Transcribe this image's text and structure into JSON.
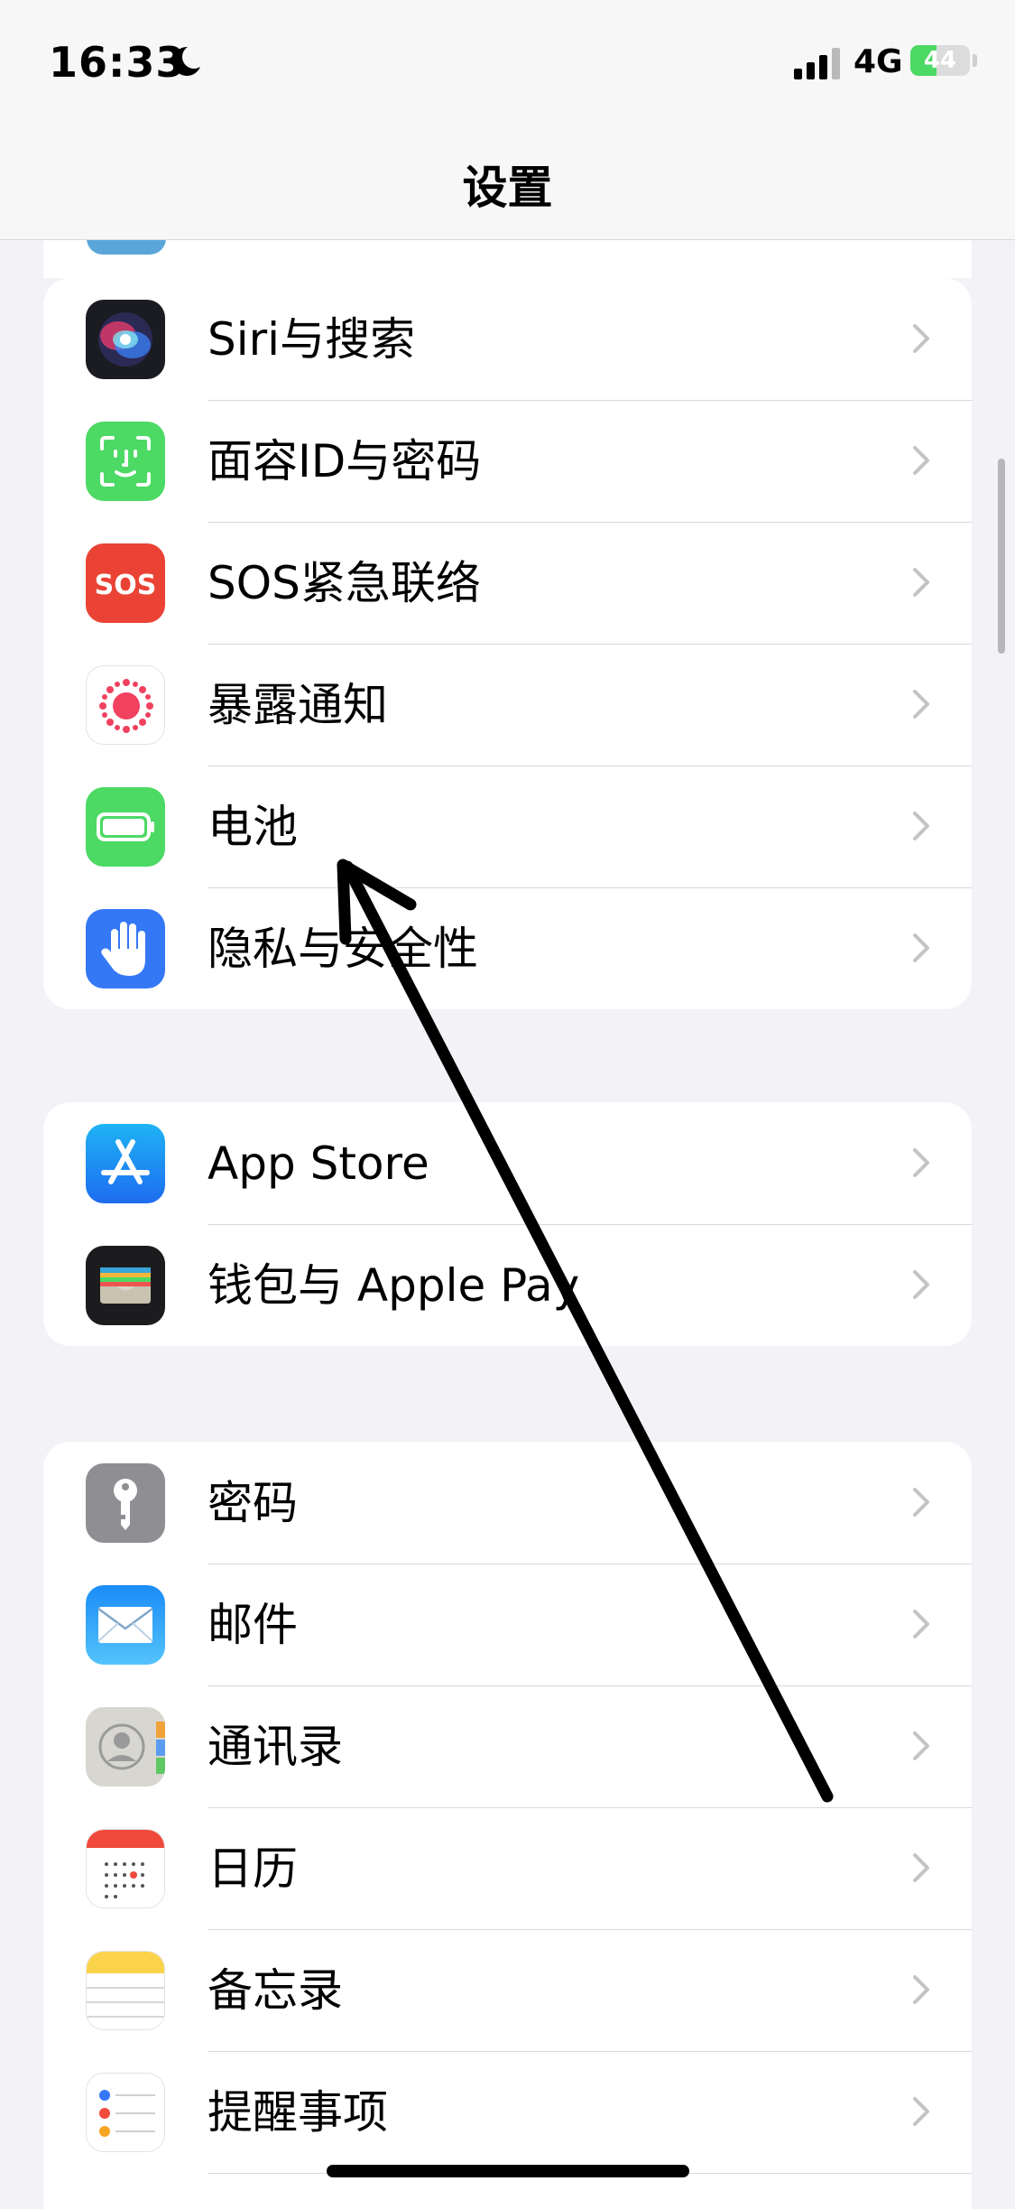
{
  "status_bar": {
    "time": "16:33",
    "network": "4G",
    "battery_text": "44",
    "battery_level": 0.44,
    "icons": [
      "moon-icon",
      "signal-icon",
      "battery-icon"
    ]
  },
  "nav": {
    "title": "设置"
  },
  "groups": [
    {
      "items": [
        {
          "label": "Siri与搜索",
          "icon": "siri-icon"
        },
        {
          "label": "面容ID与密码",
          "icon": "face-id-icon"
        },
        {
          "label": "SOS紧急联络",
          "icon": "sos-icon",
          "icon_text": "SOS"
        },
        {
          "label": "暴露通知",
          "icon": "exposure-notification-icon"
        },
        {
          "label": "电池",
          "icon": "battery-settings-icon"
        },
        {
          "label": "隐私与安全性",
          "icon": "privacy-hand-icon"
        }
      ]
    },
    {
      "items": [
        {
          "label": "App Store",
          "icon": "app-store-icon"
        },
        {
          "label": "钱包与 Apple Pay",
          "icon": "wallet-icon"
        }
      ]
    },
    {
      "items": [
        {
          "label": "密码",
          "icon": "key-icon"
        },
        {
          "label": "邮件",
          "icon": "mail-icon"
        },
        {
          "label": "通讯录",
          "icon": "contacts-icon"
        },
        {
          "label": "日历",
          "icon": "calendar-icon"
        },
        {
          "label": "备忘录",
          "icon": "notes-icon"
        },
        {
          "label": "提醒事项",
          "icon": "reminders-icon"
        }
      ]
    }
  ],
  "colors": {
    "background": "#f2f2f7",
    "green": "#4cd964",
    "sos_red": "#ea4335",
    "blue": "#3478f6",
    "chevron": "#c4c4c7"
  }
}
